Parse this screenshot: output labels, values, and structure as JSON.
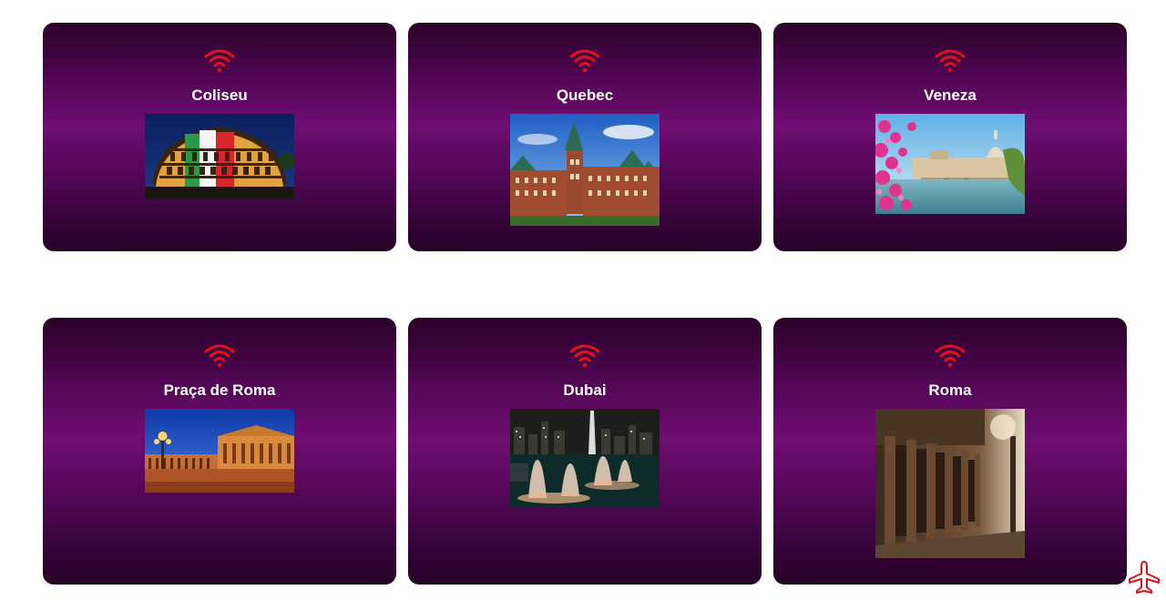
{
  "accent_color": "#e0111b",
  "card_gradient": [
    "#2a0127",
    "#700d72",
    "#260125"
  ],
  "cards": [
    {
      "title": "Coliseu",
      "icon": "wifi-icon",
      "image": "colosseum-night-lit"
    },
    {
      "title": "Quebec",
      "icon": "wifi-icon",
      "image": "chateau-frontenac"
    },
    {
      "title": "Veneza",
      "icon": "wifi-icon",
      "image": "river-with-dome-and-flowers"
    },
    {
      "title": "Praça de Roma",
      "icon": "wifi-icon",
      "image": "st-peters-square-dusk"
    },
    {
      "title": "Dubai",
      "icon": "wifi-icon",
      "image": "dubai-fountain-night"
    },
    {
      "title": "Roma",
      "icon": "wifi-icon",
      "image": "ancient-colonnade-street"
    }
  ],
  "floating_icon": "airplane-icon"
}
